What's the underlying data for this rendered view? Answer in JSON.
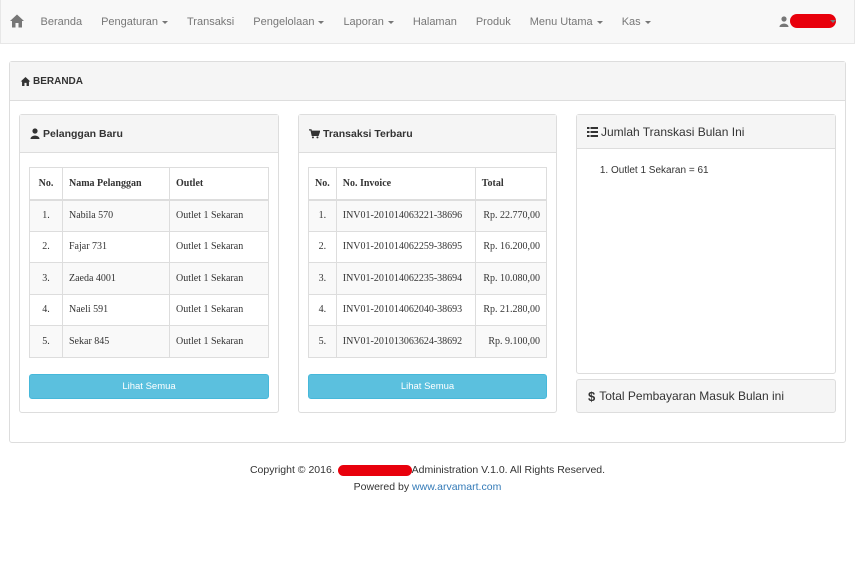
{
  "navbar": {
    "items": [
      {
        "label": "Beranda",
        "dropdown": false
      },
      {
        "label": "Pengaturan",
        "dropdown": true
      },
      {
        "label": "Transaksi",
        "dropdown": false
      },
      {
        "label": "Pengelolaan",
        "dropdown": true
      },
      {
        "label": "Laporan",
        "dropdown": true
      },
      {
        "label": "Halaman",
        "dropdown": false
      },
      {
        "label": "Produk",
        "dropdown": false
      },
      {
        "label": "Menu Utama",
        "dropdown": true
      },
      {
        "label": "Kas",
        "dropdown": true
      }
    ]
  },
  "page": {
    "title": "BERANDA"
  },
  "pelanggan": {
    "title": "Pelanggan Baru",
    "headers": [
      "No.",
      "Nama Pelanggan",
      "Outlet"
    ],
    "rows": [
      [
        "1.",
        "Nabila 570",
        "Outlet 1 Sekaran"
      ],
      [
        "2.",
        "Fajar 731",
        "Outlet 1 Sekaran"
      ],
      [
        "3.",
        "Zaeda 4001",
        "Outlet 1 Sekaran"
      ],
      [
        "4.",
        "Naeli 591",
        "Outlet 1 Sekaran"
      ],
      [
        "5.",
        "Sekar 845",
        "Outlet 1 Sekaran"
      ]
    ],
    "button": "Lihat Semua"
  },
  "transaksi": {
    "title": "Transaksi Terbaru",
    "headers": [
      "No.",
      "No. Invoice",
      "Total"
    ],
    "rows": [
      [
        "1.",
        "INV01-201014063221-38696",
        "Rp. 22.770,00"
      ],
      [
        "2.",
        "INV01-201014062259-38695",
        "Rp. 16.200,00"
      ],
      [
        "3.",
        "INV01-201014062235-38694",
        "Rp. 10.080,00"
      ],
      [
        "4.",
        "INV01-201014062040-38693",
        "Rp. 21.280,00"
      ],
      [
        "5.",
        "INV01-201013063624-38692",
        "Rp. 9.100,00"
      ]
    ],
    "button": "Lihat Semua"
  },
  "jumlah": {
    "title": "Jumlah Transkasi Bulan Ini",
    "items": [
      "Outlet 1 Sekaran = 61"
    ]
  },
  "pembayaran": {
    "title": "Total Pembayaran Masuk Bulan ini"
  },
  "footer": {
    "copyright_prefix": "Copyright © 2016.",
    "copyright_suffix": "Administration V.1.0. All Rights Reserved.",
    "powered_by": "Powered by",
    "link": "www.arvamart.com"
  },
  "colors": {
    "accent": "#5bc0de",
    "link": "#337ab7",
    "redaction": "#e8000c"
  }
}
